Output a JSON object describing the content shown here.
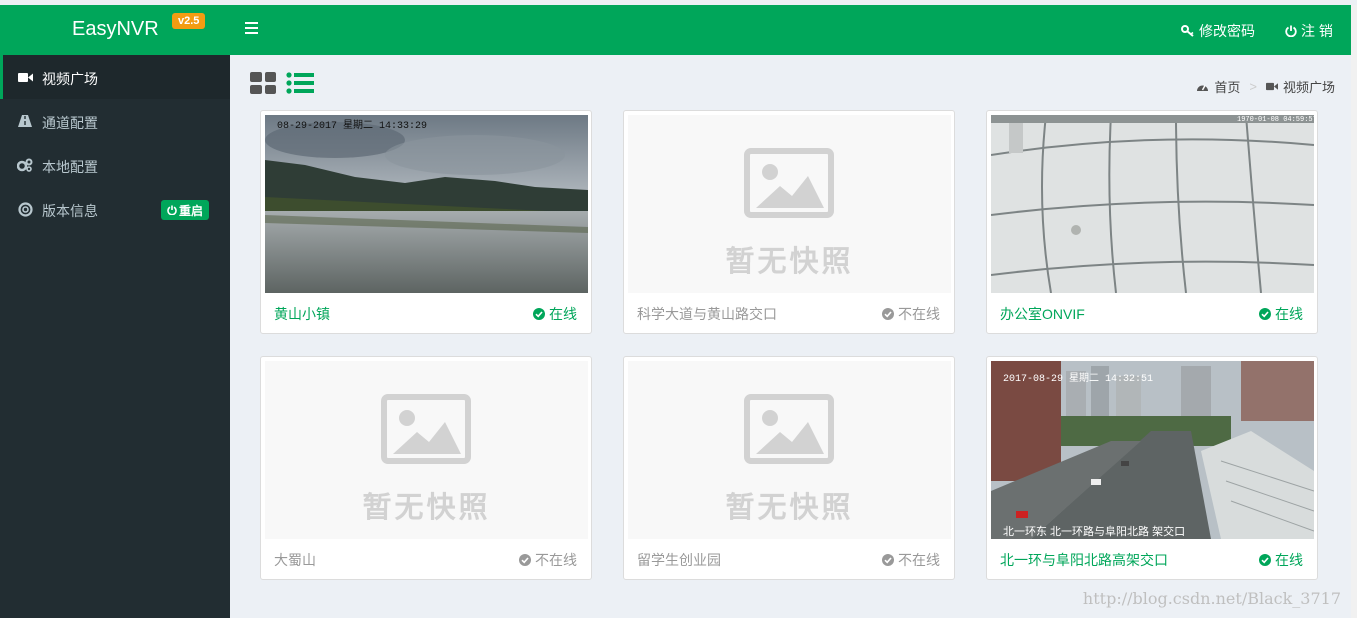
{
  "app": {
    "brand": "EasyNVR",
    "version": "v2.5"
  },
  "sidebar": {
    "items": [
      {
        "label": "视频广场",
        "icon": "video-camera-icon",
        "active": true
      },
      {
        "label": "通道配置",
        "icon": "road-icon"
      },
      {
        "label": "本地配置",
        "icon": "cogs-icon"
      },
      {
        "label": "版本信息",
        "icon": "lifebuoy-icon",
        "badge": "重启"
      }
    ]
  },
  "topbar": {
    "change_password": "修改密码",
    "logout": "注 销"
  },
  "breadcrumb": {
    "home": "首页",
    "separator": ">",
    "current": "视频广场"
  },
  "placeholder_text": "暂无快照",
  "channels": [
    {
      "name": "黄山小镇",
      "status": "在线",
      "online": true,
      "snapshot": "lake",
      "overlay": "08-29-2017 星期二 14:33:29"
    },
    {
      "name": "科学大道与黄山路交口",
      "status": "不在线",
      "online": false,
      "snapshot": "none"
    },
    {
      "name": "办公室ONVIF",
      "status": "在线",
      "online": true,
      "snapshot": "ceiling",
      "overlay": "1970-01-08 04:59:57"
    },
    {
      "name": "大蜀山",
      "status": "不在线",
      "online": false,
      "snapshot": "none"
    },
    {
      "name": "留学生创业园",
      "status": "不在线",
      "online": false,
      "snapshot": "none"
    },
    {
      "name": "北一环与阜阳北路高架交口",
      "status": "在线",
      "online": true,
      "snapshot": "street",
      "overlay": "2017-08-29 星期二 14:32:51",
      "overlay2": "北一环东 北一环路与阜阳北路 架交口"
    }
  ],
  "watermark": "http://blog.csdn.net/Black_3717",
  "colors": {
    "brand": "#00a65a",
    "sidebar": "#222d32",
    "badge": "#f39c12",
    "offline": "#999999"
  }
}
